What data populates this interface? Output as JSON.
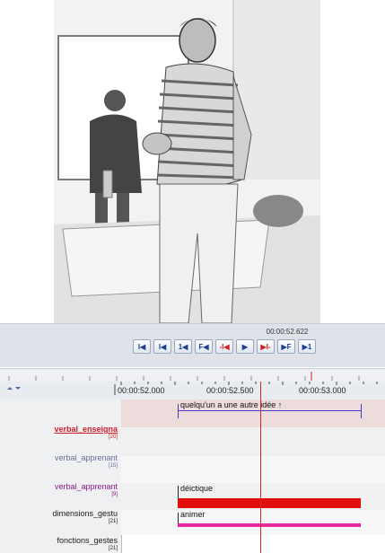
{
  "player": {
    "current_time": "00:00:52.622",
    "buttons": [
      {
        "label": "I◀",
        "name": "go-to-begin-button"
      },
      {
        "label": "I◀",
        "name": "previous-frame-button"
      },
      {
        "label": "1◀",
        "name": "step-back-button"
      },
      {
        "label": "F◀",
        "name": "previous-second-button"
      },
      {
        "label": "-I◀",
        "name": "selection-start-button"
      },
      {
        "label": "▶",
        "name": "play-button"
      },
      {
        "label": "▶I-",
        "name": "selection-end-button"
      },
      {
        "label": "▶F",
        "name": "next-second-button"
      },
      {
        "label": "▶1",
        "name": "step-forward-button"
      }
    ]
  },
  "timeline": {
    "ticks": [
      "00:00:52.000",
      "00:00:52.500",
      "00:00:53.000"
    ],
    "tiers": [
      {
        "name": "verbal_enseigna",
        "count": "[20]",
        "color": "#d0202b"
      },
      {
        "name": "verbal_apprenant",
        "count": "[15]",
        "color": "#6b6f9a"
      },
      {
        "name": "verbal_apprenant",
        "count": "[9]",
        "color": "#8b1c8c"
      },
      {
        "name": "dimensions_gestu",
        "count": "[21]",
        "color": "#1a1a1a"
      },
      {
        "name": "fonctions_gestes",
        "count": "[21]",
        "color": "#1a1a1a"
      }
    ],
    "annotations": {
      "verbal": "quelqu'un a une autre idée ↑",
      "dimension": "déictique",
      "fonction": "animer"
    }
  }
}
